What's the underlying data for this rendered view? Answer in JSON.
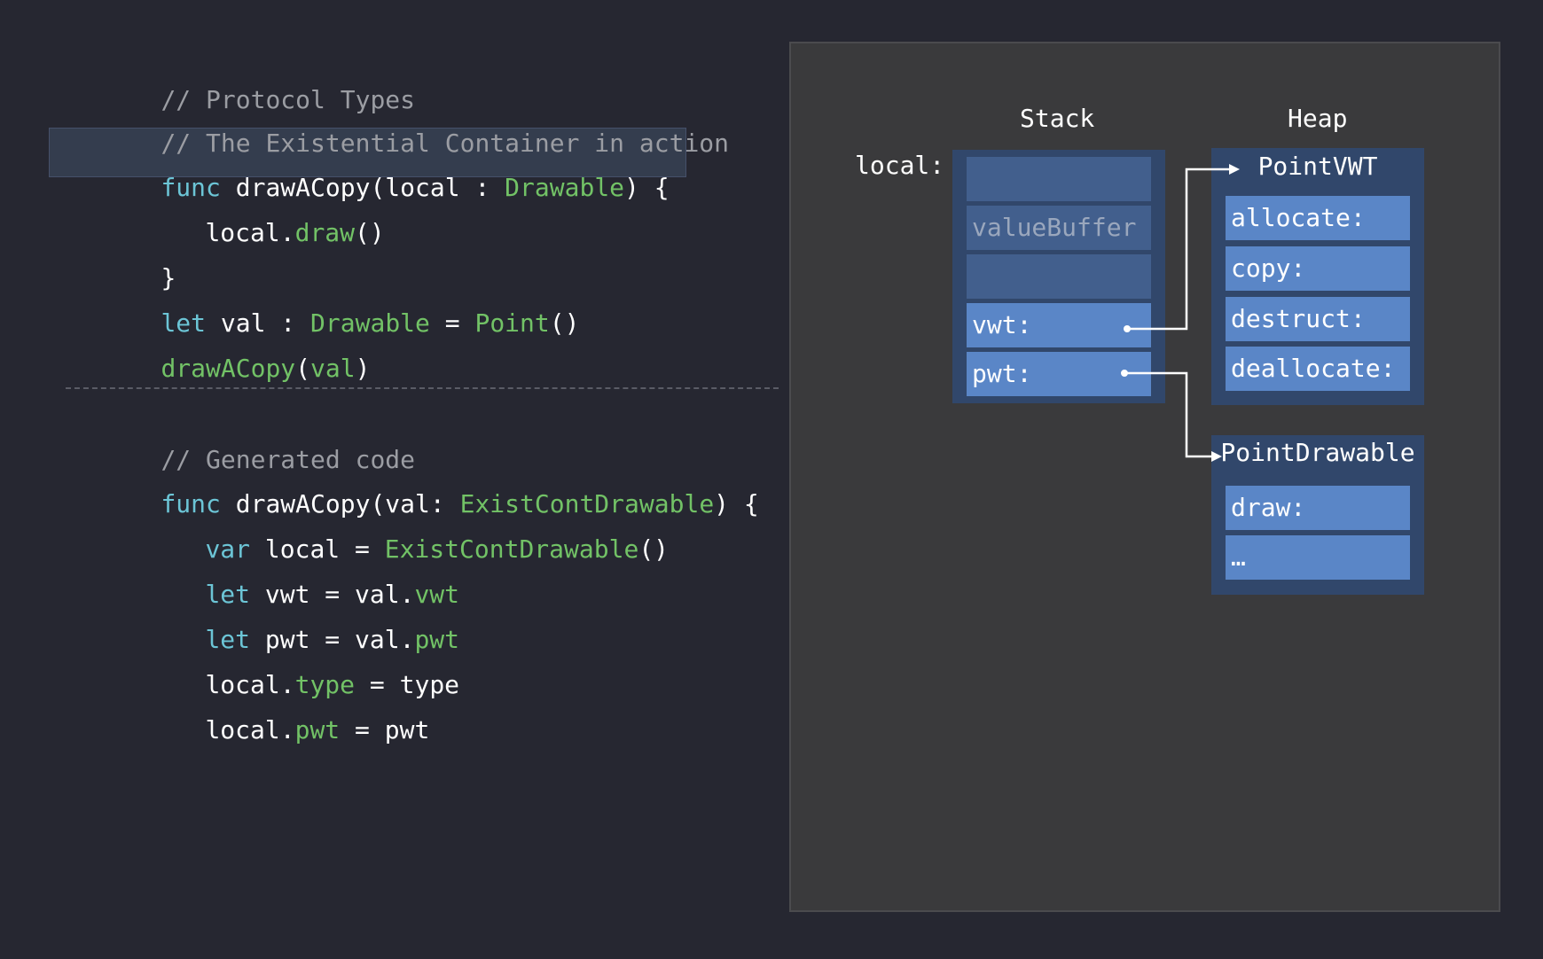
{
  "code": {
    "comment1": "// Protocol Types",
    "comment2": "// The Existential Container in action",
    "line3": {
      "kw": "func",
      "name": " drawACopy(local : ",
      "type": "Drawable",
      "end": ") {"
    },
    "line4": {
      "obj": "local.",
      "member": "draw",
      "end": "()"
    },
    "line5": "}",
    "line6": {
      "kw": "let",
      "mid": " val : ",
      "type": "Drawable",
      "eq": " = ",
      "ctor": "Point",
      "end": "()"
    },
    "line7": {
      "fn": "drawACopy",
      "open": "(",
      "arg": "val",
      "close": ")"
    },
    "comment3": "// Generated code",
    "line9": {
      "kw": "func",
      "name": " drawACopy(val: ",
      "type": "ExistContDrawable",
      "end": ") {"
    },
    "line10": {
      "kw": "var",
      "mid": " local = ",
      "type": "ExistContDrawable",
      "end": "()"
    },
    "line11": {
      "kw": "let",
      "mid": " vwt = val.",
      "member": "vwt"
    },
    "line12": {
      "kw": "let",
      "mid": " pwt = val.",
      "member": "pwt"
    },
    "line13": {
      "obj": "local.",
      "member": "type",
      "end": " = type"
    },
    "line14": {
      "obj": "local.",
      "member": "pwt",
      "end": " = pwt"
    }
  },
  "diagram": {
    "stack_label": "Stack",
    "heap_label": "Heap",
    "local_label": "local:",
    "stack_cells": [
      "",
      "valueBuffer",
      "",
      "vwt:",
      "pwt:"
    ],
    "point_vwt": {
      "title": "PointVWT",
      "entries": [
        "allocate:",
        "copy:",
        "destruct:",
        "deallocate:"
      ]
    },
    "point_drawable": {
      "title": "PointDrawable",
      "entries": [
        "draw:",
        "…"
      ]
    }
  },
  "colors": {
    "background": "#262731",
    "comment": "#9b9da3",
    "keyword": "#6cc5d6",
    "type": "#72c266",
    "panel": "#3a3a3c",
    "cell_dark": "#425f8d",
    "cell_light": "#5a86c7"
  }
}
